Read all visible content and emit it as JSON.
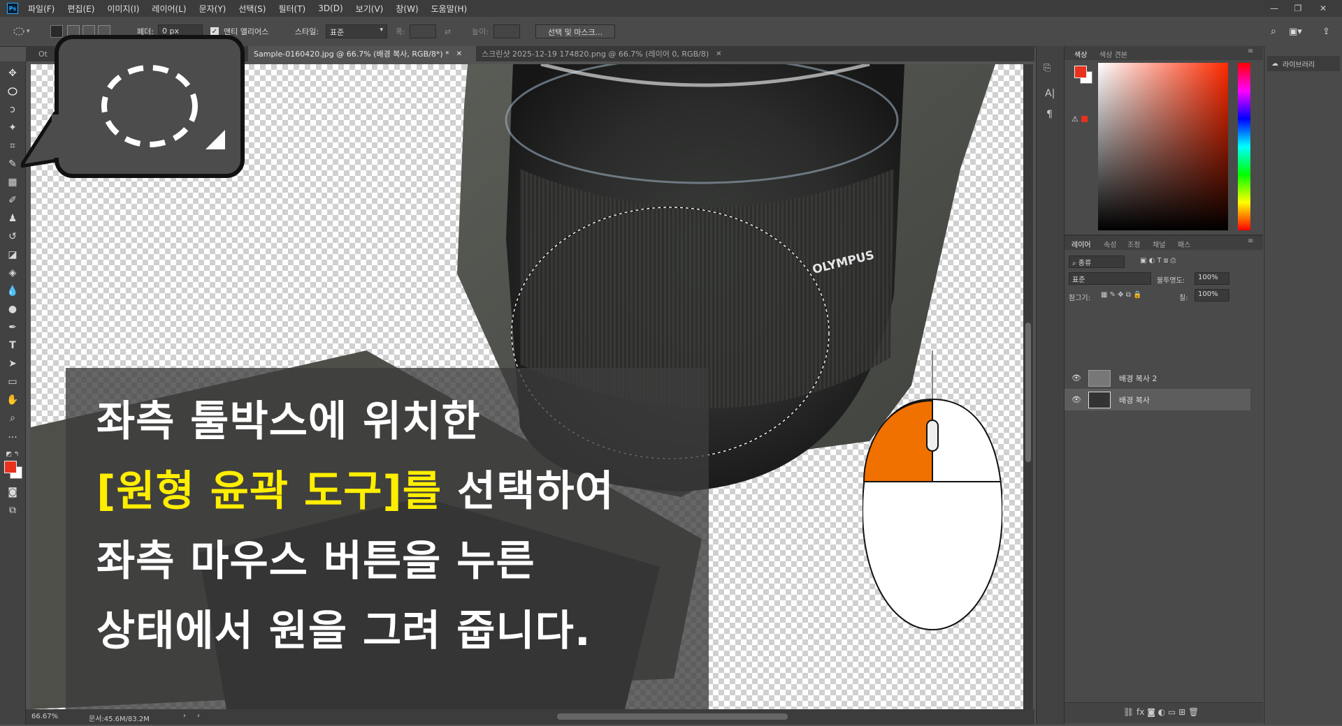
{
  "menu": {
    "items": [
      "파일(F)",
      "편집(E)",
      "이미지(I)",
      "레이어(L)",
      "문자(Y)",
      "선택(S)",
      "필터(T)",
      "3D(D)",
      "보기(V)",
      "창(W)",
      "도움말(H)"
    ]
  },
  "options": {
    "feather_label": "페더:",
    "feather_value": "0 px",
    "antialias_label": "앤티 앨리어스",
    "style_label": "스타일:",
    "style_value": "표준",
    "width_label": "폭:",
    "height_label": "높이:",
    "select_mask_button": "선택 및 마스크..."
  },
  "tabs": [
    {
      "label": "Sample-0160420.jpg @ 66.7% (배경 복사, RGB/8*) *",
      "active": true
    },
    {
      "label": "스크린샷 2025-12-19 174820.png @ 66.7% (레이어 0, RGB/8)",
      "active": false
    }
  ],
  "tab_partial": "Ot",
  "caption": {
    "line1": "좌측 툴박스에 위치한",
    "line2_highlight": "[원형 윤곽 도구]를",
    "line2_rest": " 선택하여",
    "line3": "좌측 마우스 버튼을 누른",
    "line4": "상태에서 원을 그려 줍니다."
  },
  "photo_text": "OLYMPUS",
  "status": {
    "zoom": "66.67%",
    "doc": "문서:45.6M/83.2M"
  },
  "color_panel": {
    "tabs": [
      "색상",
      "색상 견본"
    ],
    "foreground": "#e8321e",
    "background": "#ffffff"
  },
  "layers_panel": {
    "tabs": [
      "레이어",
      "속성",
      "조정",
      "채널",
      "패스"
    ],
    "filter_label": "종류",
    "blend_mode": "표준",
    "opacity_label": "불투명도:",
    "opacity_value": "100%",
    "lock_label": "잠그기:",
    "fill_label": "칠:",
    "fill_value": "100%",
    "layers": [
      {
        "name": "배경 복사 2",
        "selected": false
      },
      {
        "name": "배경 복사",
        "selected": true
      }
    ]
  },
  "library": {
    "label": "라이브러리"
  },
  "colors": {
    "accent_orange": "#f07000",
    "highlight_yellow": "#ffee00"
  }
}
